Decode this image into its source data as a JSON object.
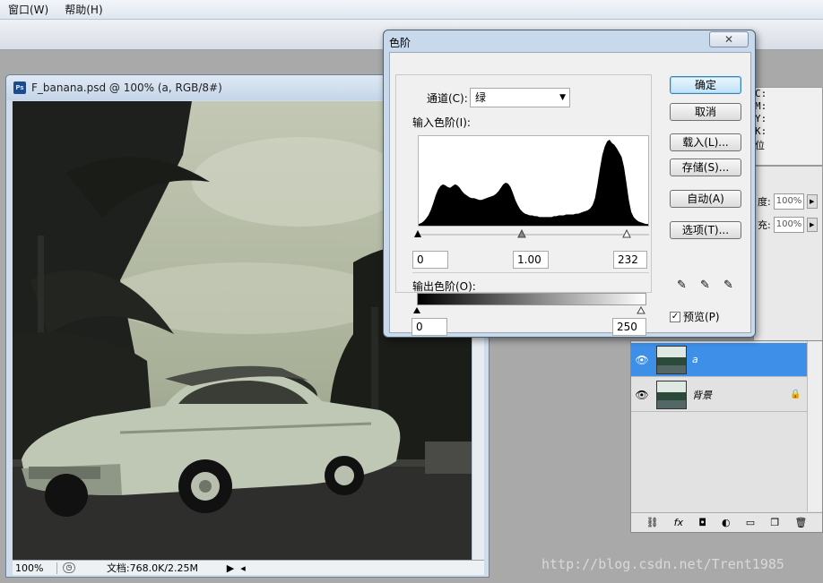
{
  "menubar": {
    "items": [
      "窗口(W)",
      "帮助(H)"
    ]
  },
  "document": {
    "title": "F_banana.psd @ 100% (a, RGB/8#)",
    "ps_icon": "Ps",
    "zoom": "100%",
    "doc_info": "文档:768.0K/2.25M"
  },
  "info_panel": {
    "lines": [
      "C:",
      "M:",
      "Y:",
      "K:",
      "位"
    ]
  },
  "layers_panel": {
    "opacity_suffix": "度:",
    "opacity_value": "100%",
    "fill_suffix": "充:",
    "fill_value": "100%",
    "layers": [
      {
        "name": "a",
        "selected": true,
        "locked": false
      },
      {
        "name": "背景",
        "selected": false,
        "locked": true
      }
    ]
  },
  "levels_dialog": {
    "title": "色阶",
    "channel_label": "通道(C):",
    "channel_value": "绿",
    "input_levels_label": "输入色阶(I):",
    "input_black": "0",
    "input_gamma": "1.00",
    "input_white": "232",
    "output_levels_label": "输出色阶(O):",
    "output_black": "0",
    "output_white": "250",
    "buttons": {
      "ok": "确定",
      "cancel": "取消",
      "load": "载入(L)...",
      "save": "存储(S)...",
      "auto": "自动(A)",
      "options": "选项(T)..."
    },
    "preview_label": "预览(P)",
    "preview_checked": true,
    "close_glyph": "✕"
  },
  "watermark": "http://blog.csdn.net/Trent1985",
  "histogram": [
    2,
    3,
    5,
    8,
    12,
    18,
    26,
    35,
    42,
    46,
    48,
    47,
    45,
    44,
    46,
    48,
    47,
    44,
    40,
    37,
    35,
    33,
    32,
    32,
    31,
    30,
    30,
    31,
    32,
    33,
    34,
    35,
    37,
    40,
    44,
    48,
    50,
    49,
    45,
    38,
    30,
    24,
    19,
    16,
    14,
    13,
    12,
    12,
    11,
    11,
    10,
    10,
    10,
    10,
    10,
    10,
    11,
    11,
    12,
    12,
    12,
    13,
    13,
    13,
    13,
    14,
    14,
    15,
    16,
    17,
    18,
    20,
    24,
    32,
    48,
    66,
    82,
    92,
    98,
    100,
    96,
    94,
    90,
    85,
    80,
    68,
    50,
    30,
    16,
    10,
    7,
    5,
    4,
    3,
    2,
    2
  ]
}
